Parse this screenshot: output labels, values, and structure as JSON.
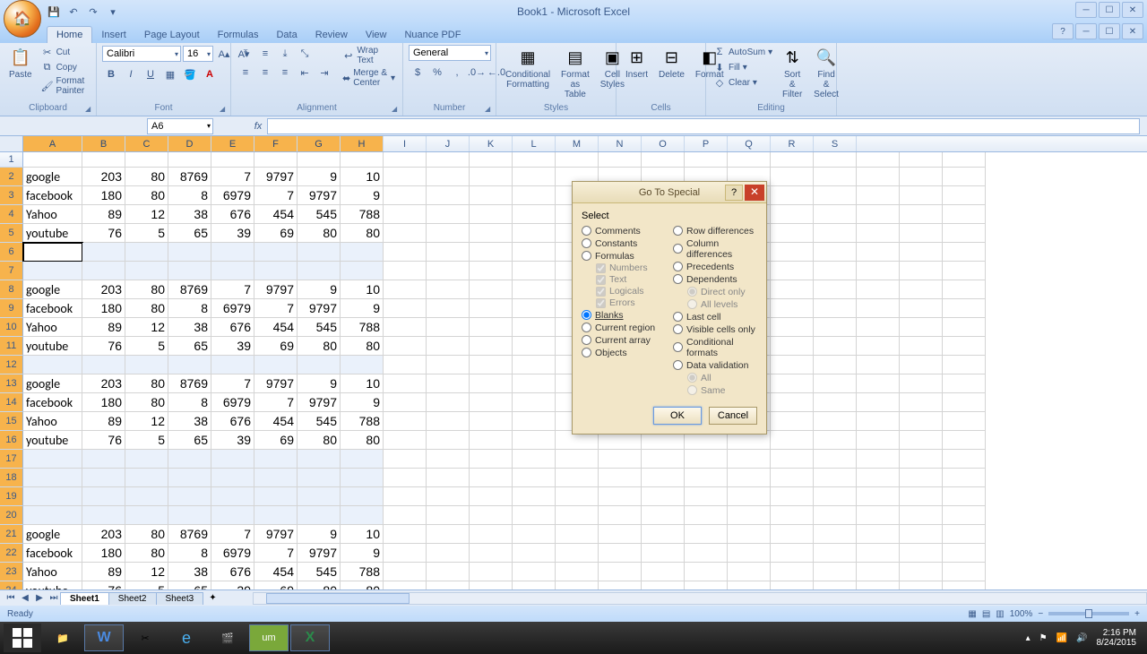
{
  "title": "Book1 - Microsoft Excel",
  "tabs": [
    "Home",
    "Insert",
    "Page Layout",
    "Formulas",
    "Data",
    "Review",
    "View",
    "Nuance PDF"
  ],
  "ribbon": {
    "clipboard": {
      "label": "Clipboard",
      "paste": "Paste",
      "cut": "Cut",
      "copy": "Copy",
      "fp": "Format Painter"
    },
    "font": {
      "label": "Font",
      "name": "Calibri",
      "size": "16"
    },
    "alignment": {
      "label": "Alignment",
      "wrap": "Wrap Text",
      "merge": "Merge & Center"
    },
    "number": {
      "label": "Number",
      "fmt": "General"
    },
    "styles": {
      "label": "Styles",
      "cf": "Conditional\nFormatting",
      "fat": "Format\nas Table",
      "cs": "Cell\nStyles"
    },
    "cells": {
      "label": "Cells",
      "ins": "Insert",
      "del": "Delete",
      "fmt": "Format"
    },
    "editing": {
      "label": "Editing",
      "as": "AutoSum",
      "fill": "Fill",
      "clr": "Clear",
      "sf": "Sort &\nFilter",
      "fs": "Find &\nSelect"
    }
  },
  "namebox": "A6",
  "columns": [
    "A",
    "B",
    "C",
    "D",
    "E",
    "F",
    "G",
    "H",
    "I",
    "J",
    "K",
    "L",
    "M",
    "N",
    "O",
    "P",
    "Q",
    "R",
    "S"
  ],
  "datarows": [
    [
      "google",
      "203",
      "80",
      "8769",
      "7",
      "9797",
      "9",
      "10"
    ],
    [
      "facebook",
      "180",
      "80",
      "8",
      "6979",
      "7",
      "9797",
      "9"
    ],
    [
      "Yahoo",
      "89",
      "12",
      "38",
      "676",
      "454",
      "545",
      "788"
    ],
    [
      "youtube",
      "76",
      "5",
      "65",
      "39",
      "69",
      "80",
      "80"
    ]
  ],
  "sheets": [
    "Sheet1",
    "Sheet2",
    "Sheet3"
  ],
  "status": "Ready",
  "zoom": "100%",
  "dialog": {
    "title": "Go To Special",
    "select": "Select",
    "left": [
      "Comments",
      "Constants",
      "Formulas"
    ],
    "checks": [
      "Numbers",
      "Text",
      "Logicals",
      "Errors"
    ],
    "left2": [
      "Blanks",
      "Current region",
      "Current array",
      "Objects"
    ],
    "right": [
      "Row differences",
      "Column differences",
      "Precedents",
      "Dependents"
    ],
    "rsub": [
      "Direct only",
      "All levels"
    ],
    "right2": [
      "Last cell",
      "Visible cells only",
      "Conditional formats",
      "Data validation"
    ],
    "rsub2": [
      "All",
      "Same"
    ],
    "ok": "OK",
    "cancel": "Cancel"
  },
  "clock": {
    "time": "2:16 PM",
    "date": "8/24/2015"
  }
}
